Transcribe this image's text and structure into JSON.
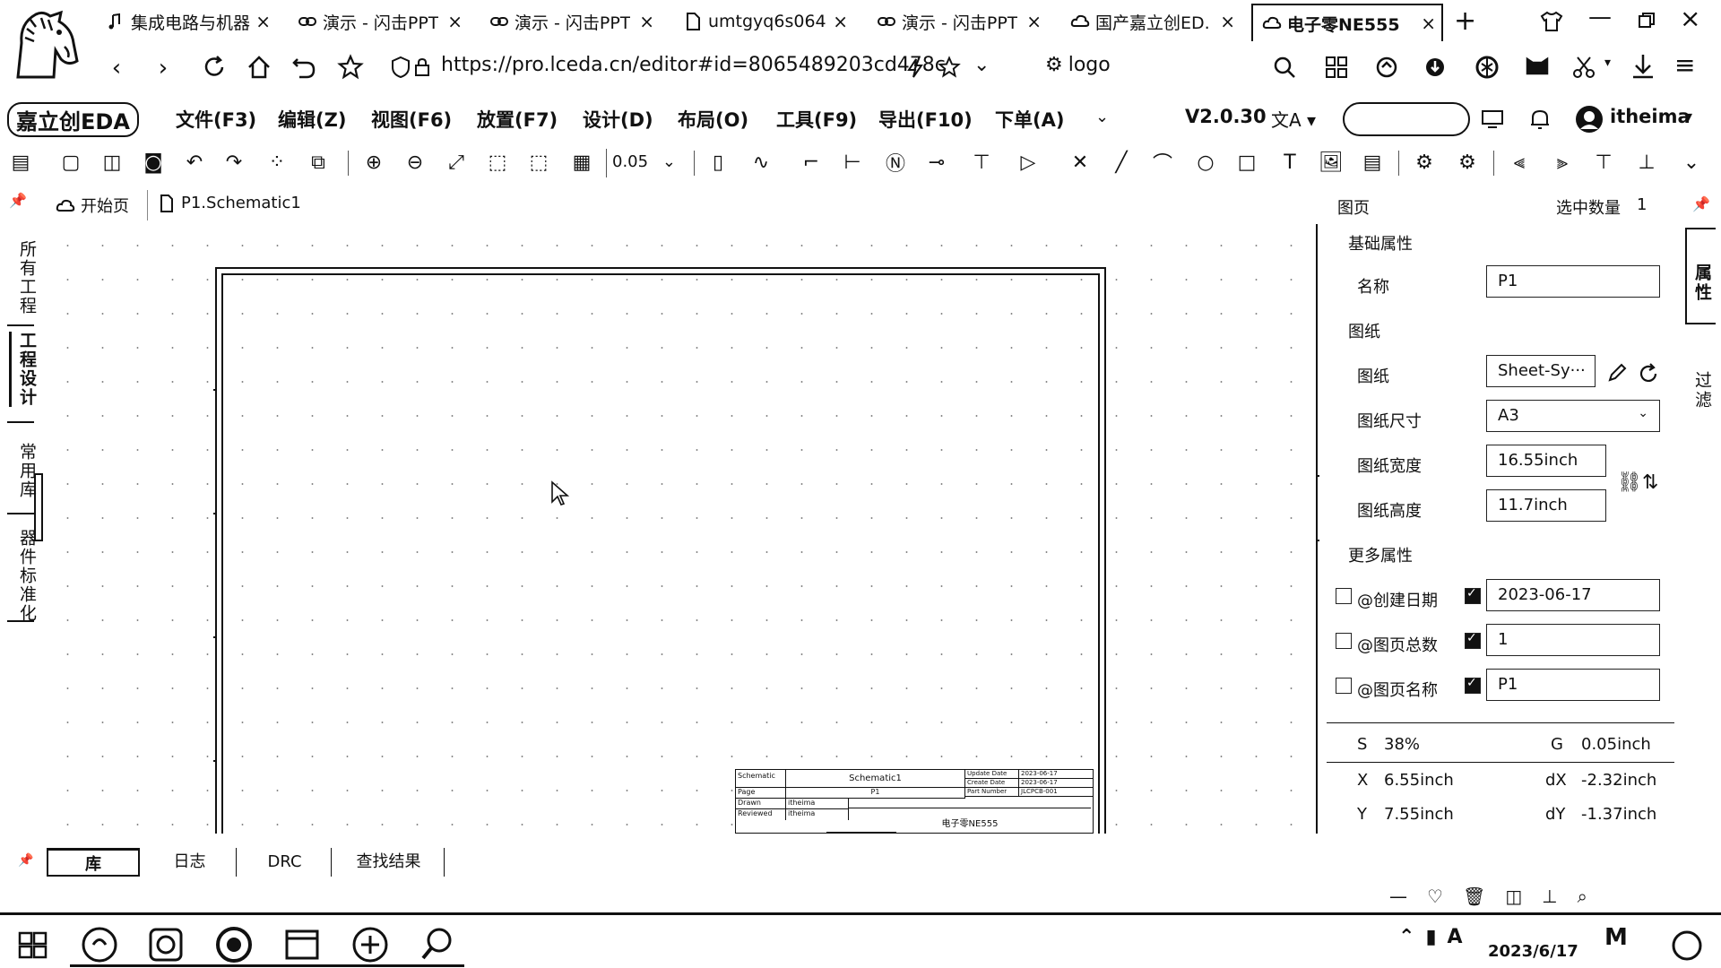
{
  "browser": {
    "tabs": [
      {
        "label": "集成电路与机器",
        "icon": "music-icon"
      },
      {
        "label": "演示 - 闪击PPT",
        "icon": "link-icon"
      },
      {
        "label": "演示 - 闪击PPT",
        "icon": "link-icon"
      },
      {
        "label": "umtgyq6s064",
        "icon": "document-icon"
      },
      {
        "label": "演示 - 闪击PPT",
        "icon": "link-icon"
      },
      {
        "label": "国产嘉立创ED.",
        "icon": "cloud-icon"
      },
      {
        "label": "电子零NE555",
        "icon": "cloud-icon",
        "active": true
      }
    ],
    "new_tab": "+",
    "url": "https://pro.lceda.cn/editor#id=8065489203cd478c",
    "bookmark_label": "logo"
  },
  "menubar": {
    "items": [
      "文件(F3)",
      "编辑(Z)",
      "视图(F6)",
      "放置(F7)",
      "设计(D)",
      "布局(O)",
      "工具(F9)",
      "导出(F10)",
      "下单(A)"
    ],
    "version": "V2.0.30",
    "user": "itheima"
  },
  "toolbar": {
    "grid_value": "0.05"
  },
  "doctabs": {
    "home": "开始页",
    "schematic": "P1.Schematic1"
  },
  "left_panel": {
    "tabs": [
      "所有工程",
      "工程设计",
      "常用库",
      "器件标准化"
    ]
  },
  "right_panel": {
    "header": "图页",
    "selected_count_label": "选中数量",
    "selected_count": "1",
    "basic_section": "基础属性",
    "name_label": "名称",
    "name_value": "P1",
    "sheet_section": "图纸",
    "sheet_label": "图纸",
    "sheet_value": "Sheet-Sy···",
    "size_label": "图纸尺寸",
    "size_value": "A3",
    "width_label": "图纸宽度",
    "width_value": "16.55inch",
    "height_label": "图纸高度",
    "height_value": "11.7inch",
    "more_section": "更多属性",
    "more_props": [
      {
        "label": "@创建日期",
        "value": "2023-06-17"
      },
      {
        "label": "@图页总数",
        "value": "1"
      },
      {
        "label": "@图页名称",
        "value": "P1"
      }
    ],
    "vtabs": [
      "属性",
      "过滤"
    ]
  },
  "status": {
    "s_label": "S",
    "s_value": "38%",
    "g_label": "G",
    "g_value": "0.05inch",
    "x_label": "X",
    "x_value": "6.55inch",
    "dx_label": "dX",
    "dx_value": "-2.32inch",
    "y_label": "Y",
    "y_value": "7.55inch",
    "dy_label": "dY",
    "dy_value": "-1.37inch"
  },
  "titleblock": {
    "schematic_label": "Schematic",
    "schematic_name": "Schematic1",
    "page_label": "Page",
    "page_value": "P1",
    "drawn_label": "Drawn",
    "drawn_value": "itheima",
    "reviewed_label": "Reviewed",
    "reviewed_value": "itheima",
    "update_label": "Update Date",
    "update_value": "2023-06-17",
    "create_label": "Create Date",
    "create_value": "2023-06-17",
    "part_label": "Part Number",
    "part_value": "JLCPCB-001",
    "project_name": "电子零NE555"
  },
  "bottom_tabs": [
    "库",
    "日志",
    "DRC",
    "查找结果"
  ],
  "taskbar": {
    "date": "2023/6/17"
  }
}
